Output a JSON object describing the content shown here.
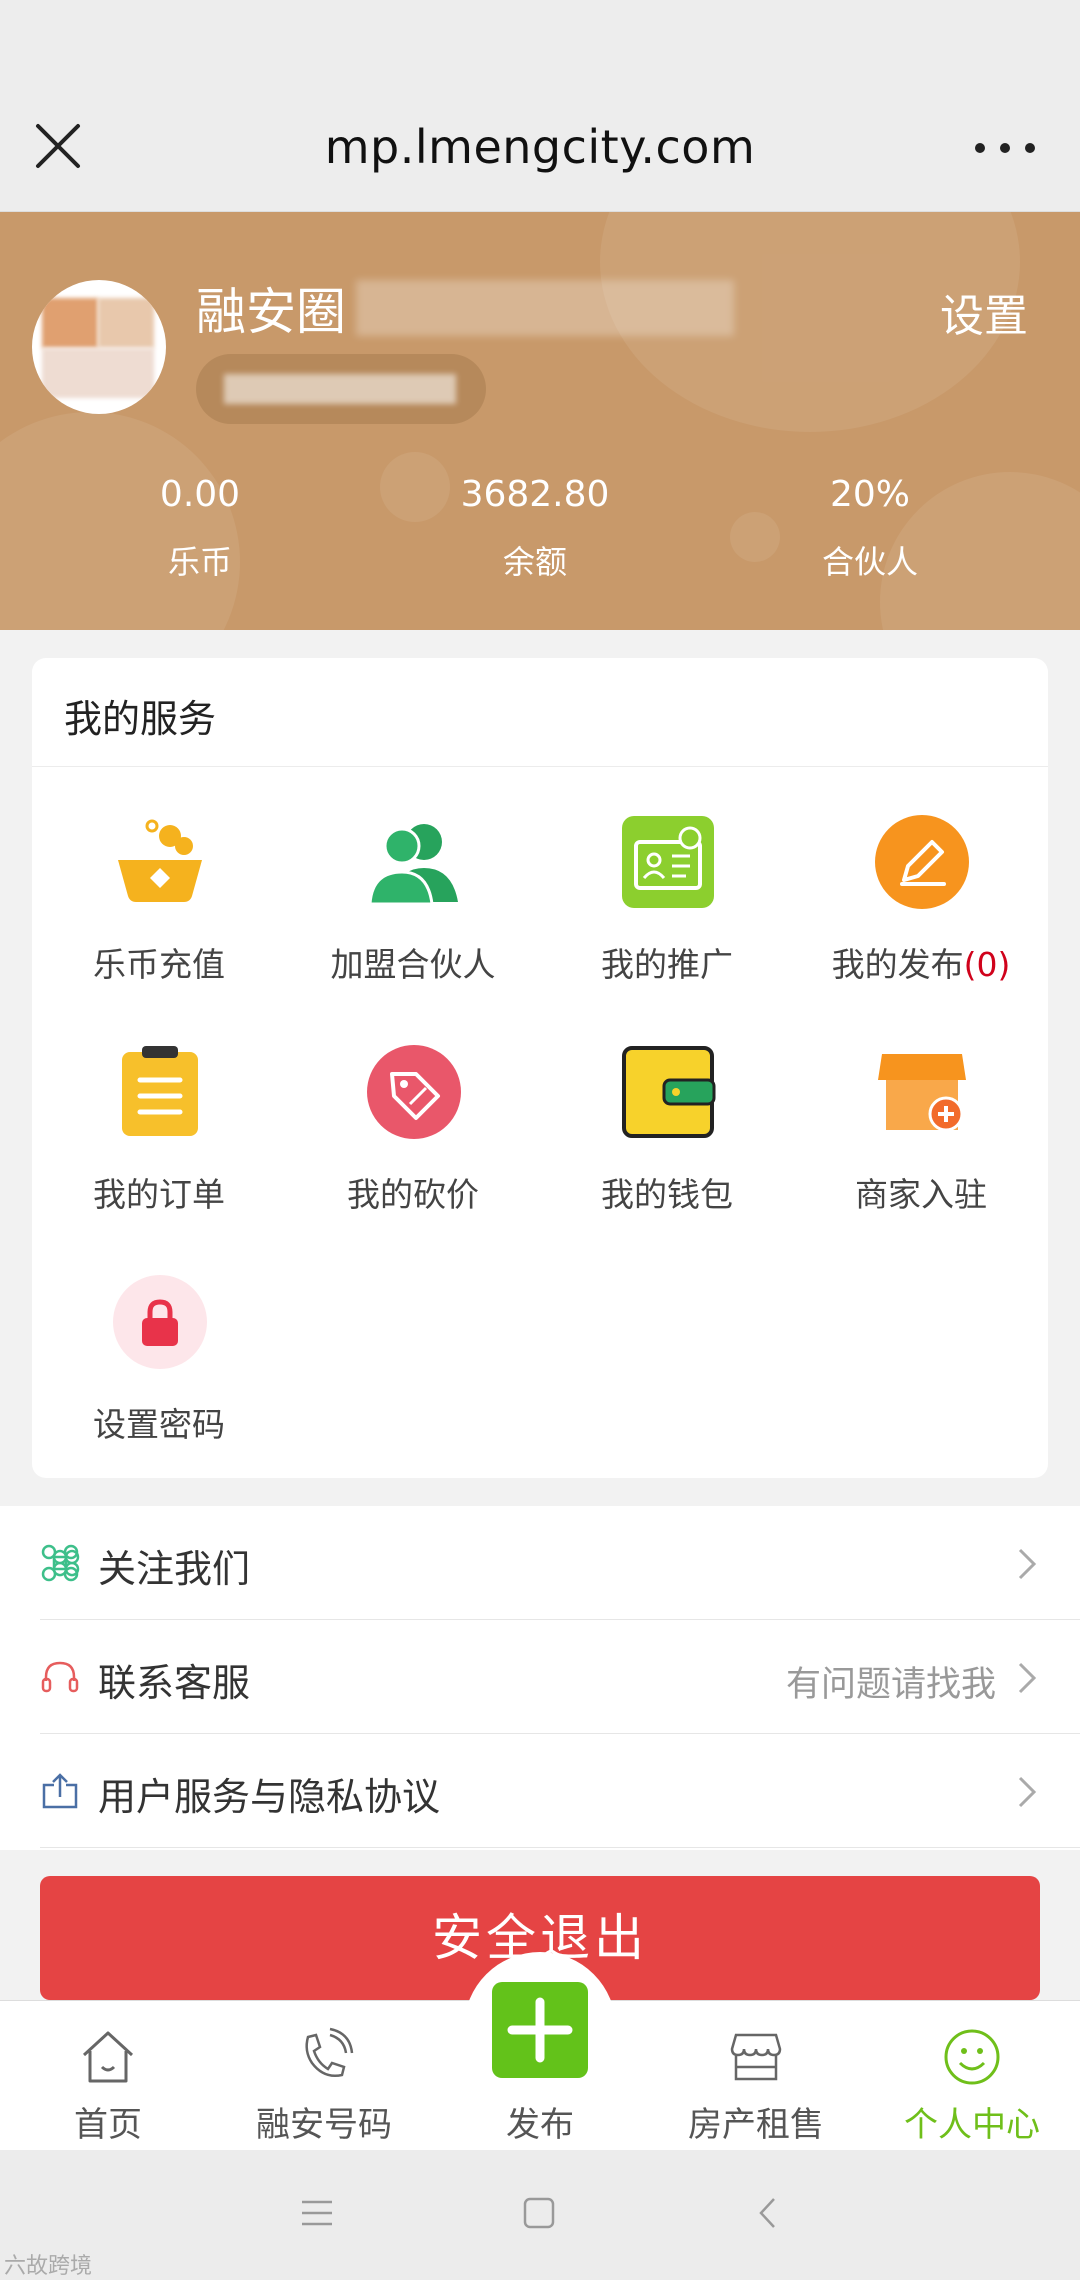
{
  "browser": {
    "url": "mp.lmengcity.com"
  },
  "profile": {
    "name": "融安圈",
    "settings_label": "设置",
    "stats": [
      {
        "value": "0.00",
        "label": "乐币"
      },
      {
        "value": "3682.80",
        "label": "余额"
      },
      {
        "value": "20%",
        "label": "合伙人"
      }
    ]
  },
  "services": {
    "title": "我的服务",
    "items": [
      {
        "label": "乐币充值",
        "icon": "coin-recharge-icon"
      },
      {
        "label": "加盟合伙人",
        "icon": "partners-icon"
      },
      {
        "label": "我的推广",
        "icon": "promotion-card-icon"
      },
      {
        "label": "我的发布",
        "count": "(0)",
        "icon": "pencil-icon"
      },
      {
        "label": "我的订单",
        "icon": "clipboard-icon"
      },
      {
        "label": "我的砍价",
        "icon": "price-tag-icon"
      },
      {
        "label": "我的钱包",
        "icon": "wallet-icon"
      },
      {
        "label": "商家入驻",
        "icon": "store-add-icon"
      },
      {
        "label": "设置密码",
        "icon": "lock-icon"
      }
    ]
  },
  "menu": [
    {
      "label": "关注我们",
      "sub": "",
      "icon": "command-icon",
      "color": "#3dbf8a"
    },
    {
      "label": "联系客服",
      "sub": "有问题请找我",
      "icon": "headset-icon",
      "color": "#e65d5d"
    },
    {
      "label": "用户服务与隐私协议",
      "sub": "",
      "icon": "share-upload-icon",
      "color": "#4a6fa5"
    }
  ],
  "logout_label": "安全退出",
  "tabbar": [
    {
      "label": "首页",
      "icon": "home-icon"
    },
    {
      "label": "融安号码",
      "icon": "phone-icon"
    },
    {
      "label": "发布",
      "icon": "plus-icon"
    },
    {
      "label": "房产租售",
      "icon": "store-icon"
    },
    {
      "label": "个人中心",
      "icon": "smiley-icon",
      "active": true
    }
  ],
  "watermark": "六故跨境",
  "colors": {
    "header": "#c8996a",
    "accent": "#63c21a",
    "danger": "#e54444"
  }
}
